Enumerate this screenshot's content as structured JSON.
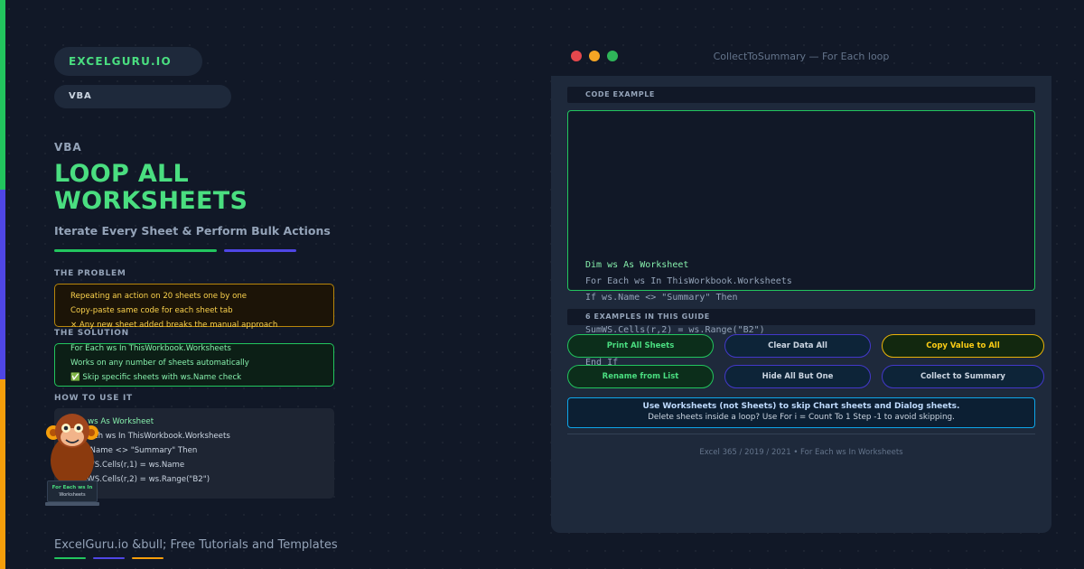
{
  "brand": "EXCELGURU.IO",
  "category": "VBA",
  "kicker": "VBA",
  "title_line1": "LOOP ALL",
  "title_line2": "WORKSHEETS",
  "subtitle": "Iterate Every Sheet & Perform Bulk Actions",
  "problem": {
    "label": "THE PROBLEM",
    "items": [
      "Repeating an action on 20 sheets one by one",
      "Copy-paste same code for each sheet tab",
      "× Any new sheet added breaks the manual approach"
    ]
  },
  "solution": {
    "label": "THE SOLUTION",
    "items": [
      "For Each ws In ThisWorkbook.Worksheets",
      "Works on any number of sheets automatically",
      "✅ Skip specific sheets with ws.Name check"
    ]
  },
  "how": {
    "label": "HOW TO USE IT",
    "items": [
      "Dim ws As Worksheet",
      "For Each ws In ThisWorkbook.Worksheets",
      "If ws.Name <> \"Summary\" Then",
      "SumWS.Cells(r,1) = ws.Name",
      "SumWS.Cells(r,2) = ws.Range(\"B2\")"
    ]
  },
  "mascot": {
    "label_line1": "For Each ws In",
    "label_line2": "Worksheets"
  },
  "footer": "ExcelGuru.io &bull; Free Tutorials and Templates",
  "window": {
    "title": "CollectToSummary — For Each loop",
    "code_header": "CODE EXAMPLE",
    "code_lines": [
      "Dim ws As Worksheet",
      "For Each ws In ThisWorkbook.Worksheets",
      "If ws.Name <> \"Summary\" Then",
      "SumWS.Cells(r,2) = ws.Range(\"B2\")",
      "End If"
    ],
    "examples_header": "6 EXAMPLES IN THIS GUIDE",
    "buttons": [
      "Print All Sheets",
      "Clear Data All",
      "Copy Value to All",
      "Rename from List",
      "Hide All But One",
      "Collect to Summary"
    ],
    "note_line1": "Use Worksheets (not Sheets) to skip Chart sheets and Dialog sheets.",
    "note_line2": "Delete sheets inside a loop? Use For i = Count To 1 Step -1 to avoid skipping.",
    "footer": "Excel 365 / 2019 / 2021 • For Each ws In Worksheets"
  },
  "colors": {
    "background": "#111827",
    "accent_green": "#22c55e",
    "accent_indigo": "#4f46e5",
    "accent_amber": "#f59e0b",
    "title_green": "#4ade80"
  }
}
